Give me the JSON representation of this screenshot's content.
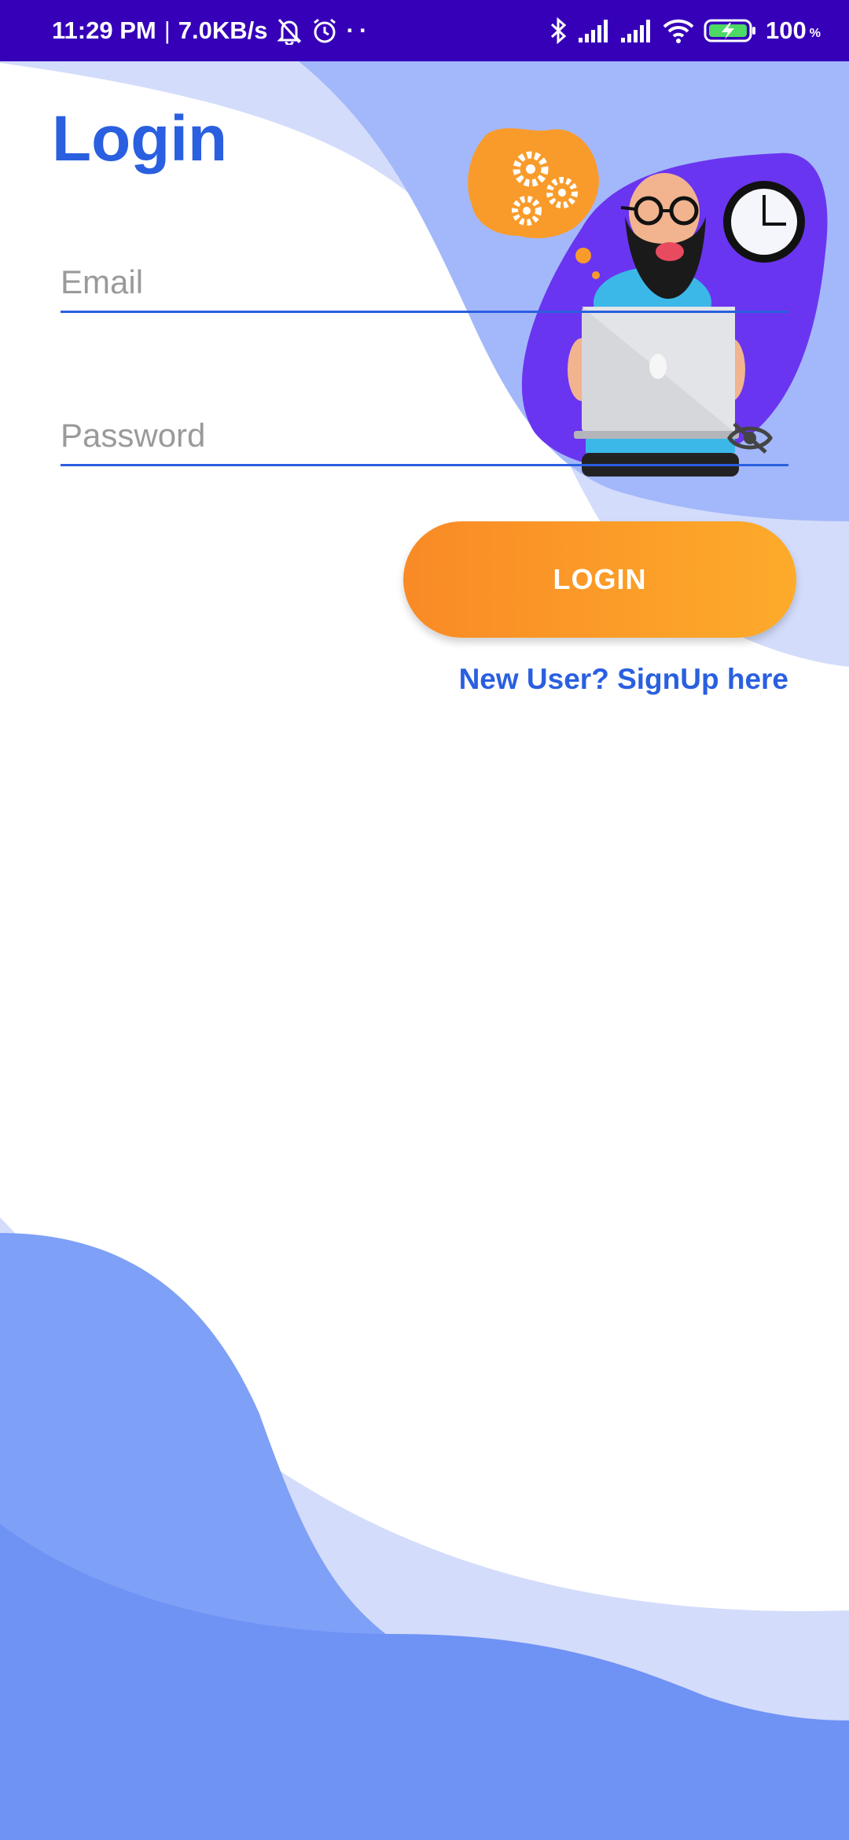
{
  "status_bar": {
    "time": "11:29 PM",
    "separator": "|",
    "speed": "7.0KB/s",
    "dots": "··",
    "battery": "100",
    "battery_unit": "%",
    "icons": [
      "bell-off-icon",
      "alarm-icon",
      "bluetooth-icon",
      "signal-icon",
      "signal-icon",
      "wifi-icon",
      "battery-charging-icon"
    ]
  },
  "login": {
    "title": "Login",
    "email_placeholder": "Email",
    "password_placeholder": "Password",
    "password_toggle_icon": "eye-off-icon",
    "button_label": "LOGIN",
    "signup_link": "New User? SignUp here"
  },
  "colors": {
    "status_bar": "#3600b8",
    "accent": "#2a5fe0",
    "button_start": "#f98a26",
    "button_end": "#fdab2a"
  }
}
